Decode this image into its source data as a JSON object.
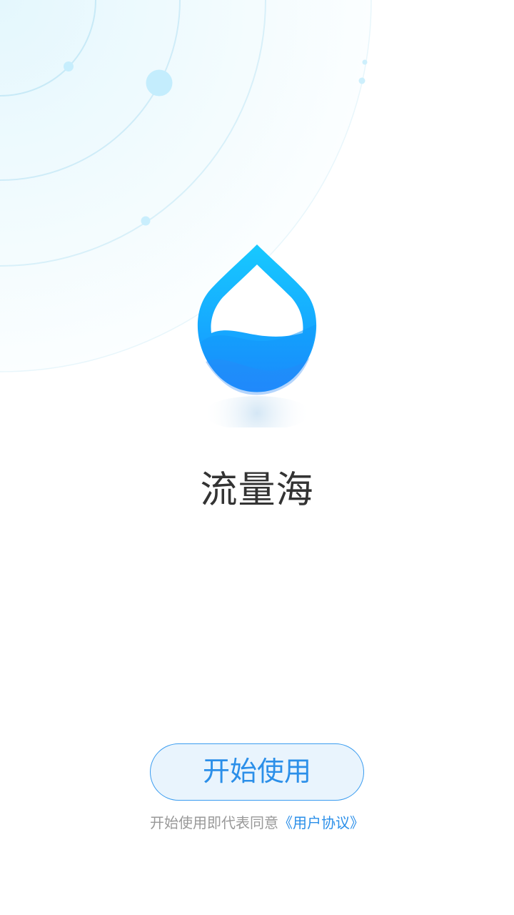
{
  "app": {
    "name": "流量海"
  },
  "actions": {
    "start_label": "开始使用"
  },
  "agreement": {
    "prefix": "开始使用即代表同意",
    "link_label": "《用户协议》"
  },
  "icons": {
    "logo": "water-drop-logo-icon"
  },
  "colors": {
    "accent": "#2b8fe9",
    "button_fill": "#e9f4fd",
    "title_text": "#333333",
    "hint_text": "#999999",
    "drop_top": "#17c9ff",
    "drop_bottom": "#1690ff"
  }
}
